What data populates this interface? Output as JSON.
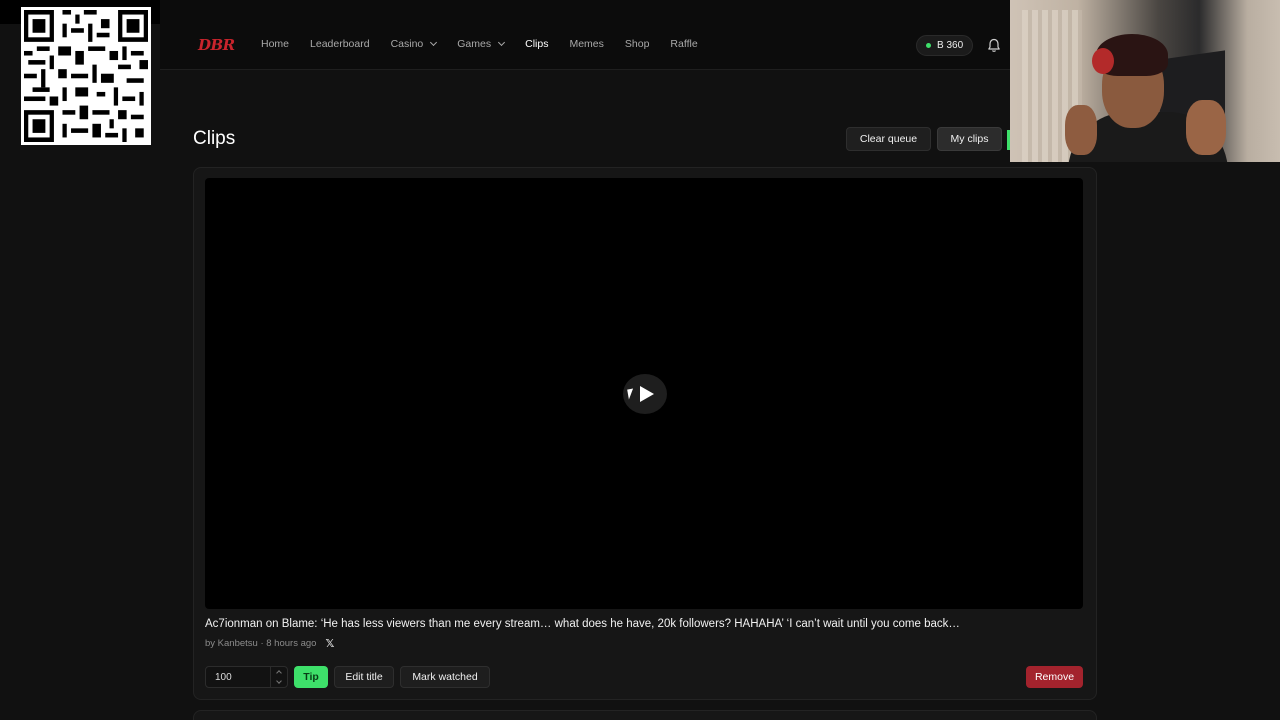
{
  "brand": {
    "logo_text": "DBR",
    "logo_color": "#c8242c"
  },
  "nav": {
    "items": [
      {
        "label": "Home",
        "dropdown": false,
        "active": false
      },
      {
        "label": "Leaderboard",
        "dropdown": false,
        "active": false
      },
      {
        "label": "Casino",
        "dropdown": true,
        "active": false
      },
      {
        "label": "Games",
        "dropdown": true,
        "active": false
      },
      {
        "label": "Clips",
        "dropdown": false,
        "active": true
      },
      {
        "label": "Memes",
        "dropdown": false,
        "active": false
      },
      {
        "label": "Shop",
        "dropdown": false,
        "active": false
      },
      {
        "label": "Raffle",
        "dropdown": false,
        "active": false
      }
    ]
  },
  "balance": {
    "text": "B 360",
    "status_color": "#3ee06a"
  },
  "page": {
    "title": "Clips",
    "clear_queue_label": "Clear queue",
    "my_clips_label": "My clips"
  },
  "clip": {
    "title": "Ac7ionman on Blame: ‘He has less viewers than me every stream… what does he have, 20k followers? HAHAHA’ ‘I can’t wait until you come back…",
    "meta": "by Kanbetsu · 8 hours ago",
    "share_icon": "x-logo-icon",
    "tip_amount": "100",
    "tip_label": "Tip",
    "edit_title_label": "Edit title",
    "mark_watched_label": "Mark watched",
    "remove_label": "Remove"
  },
  "colors": {
    "accent_green": "#3ee06a",
    "danger_red": "#a3232d",
    "background": "#111111"
  }
}
